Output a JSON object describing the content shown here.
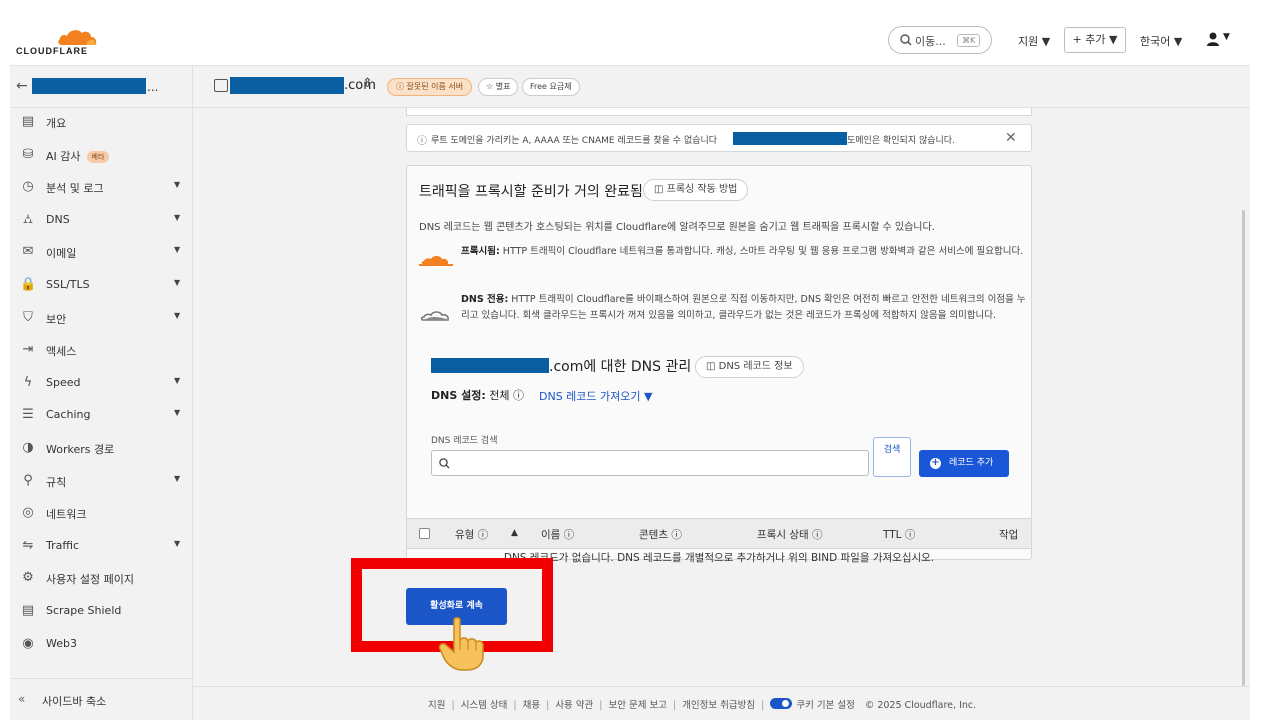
{
  "topbar": {
    "logo_text": "CLOUDFLARE",
    "search_label": "이동...",
    "search_shortcut": "⌘K",
    "support_label": "지원 ▼",
    "add_label": "+ 추가 ▼",
    "language_label": "한국어 ▼",
    "account_menu_label": "▼"
  },
  "subbar": {
    "account_suffix": "...",
    "domain_tld": ".com",
    "domain_chevron": "⌃⌄",
    "badge_warning": "ⓘ 잘못된 이름 서버",
    "badge_star": "☆ 별표",
    "badge_plan": "Free 요금제"
  },
  "sidebar": {
    "items": [
      {
        "icon": "document-icon",
        "glyph": "▤",
        "label": "개요",
        "chevron": ""
      },
      {
        "icon": "ai-audit-icon",
        "glyph": "⛁",
        "label": "AI 감사",
        "chevron": "",
        "badge": "베타"
      },
      {
        "icon": "analytics-icon",
        "glyph": "◷",
        "label": "분석 및 로그",
        "chevron": "▼"
      },
      {
        "icon": "dns-icon",
        "glyph": "⛼",
        "label": "DNS",
        "chevron": "▼"
      },
      {
        "icon": "email-icon",
        "glyph": "✉",
        "label": "이메일",
        "chevron": "▼"
      },
      {
        "icon": "lock-icon",
        "glyph": "🔒",
        "label": "SSL/TLS",
        "chevron": "▼"
      },
      {
        "icon": "shield-icon",
        "glyph": "⛉",
        "label": "보안",
        "chevron": "▼"
      },
      {
        "icon": "access-icon",
        "glyph": "⇥",
        "label": "액세스",
        "chevron": ""
      },
      {
        "icon": "speed-icon",
        "glyph": "ϟ",
        "label": "Speed",
        "chevron": "▼"
      },
      {
        "icon": "caching-icon",
        "glyph": "☰",
        "label": "Caching",
        "chevron": "▼"
      },
      {
        "icon": "workers-icon",
        "glyph": "◑",
        "label": "Workers 경로",
        "chevron": ""
      },
      {
        "icon": "rules-icon",
        "glyph": "⚲",
        "label": "규칙",
        "chevron": "▼"
      },
      {
        "icon": "network-icon",
        "glyph": "◎",
        "label": "네트워크",
        "chevron": ""
      },
      {
        "icon": "traffic-icon",
        "glyph": "⇋",
        "label": "Traffic",
        "chevron": "▼"
      },
      {
        "icon": "custom-pages-icon",
        "glyph": "⚙",
        "label": "사용자 설정 페이지",
        "chevron": ""
      },
      {
        "icon": "scrape-shield-icon",
        "glyph": "▤",
        "label": "Scrape Shield",
        "chevron": ""
      },
      {
        "icon": "web3-icon",
        "glyph": "◉",
        "label": "Web3",
        "chevron": ""
      }
    ],
    "collapse_label": "사이드바 축소"
  },
  "notice": {
    "text_before": "루트 도메인을 가리키는 A, AAAA 또는 CNAME 레코드를 찾을 수 없습니다",
    "text_after": "도메인은 확인되지 않습니다."
  },
  "card": {
    "title": "트래픽을 프록시할 준비가 거의 완료됨",
    "how_proxy_label": "◫ 프록싱 작동 방법",
    "description": "DNS 레코드는 웹 콘텐츠가 호스팅되는 위치를 Cloudflare에 알려주므로 원본을 숨기고 웹 트래픽을 프록시할 수 있습니다.",
    "proxied_title": "프록시됨:",
    "proxied_text": "HTTP 트래픽이 Cloudflare 네트워크를 통과합니다. 캐싱, 스마트 라우팅 및 웹 응용 프로그램 방화벽과 같은 서비스에 필요합니다.",
    "dns_only_title": "DNS 전용:",
    "dns_only_text": "HTTP 트래픽이 Cloudflare를 바이패스하여 원본으로 직접 이동하지만, DNS 확인은 여전히 빠르고 안전한 네트워크의 이점을 누리고 있습니다. 회색 클라우드는 프록시가 꺼져 있음을 의미하고, 클라우드가 없는 것은 레코드가 프록싱에 적합하지 않음을 의미합니다.",
    "dns_manage_suffix": ".com에 대한 DNS 관리",
    "dns_record_info_label": "◫ DNS 레코드 정보",
    "dns_settings_label": "DNS 설정:",
    "dns_settings_value": "전체 ⓘ",
    "dns_import_label": "DNS 레코드 가져오기 ▼",
    "search_label": "DNS 레코드 검색",
    "search_button_label": "검색",
    "add_record_label": "레코드 추가",
    "columns": [
      "유형 ⓘ",
      "▲",
      "이름 ⓘ",
      "콘텐츠 ⓘ",
      "프록시 상태 ⓘ",
      "TTL ⓘ",
      "작업"
    ],
    "empty_message": "DNS 레코드가 없습니다. DNS 레코드를 개별적으로 추가하거나 위의 BIND 파일을 가져오십시오."
  },
  "continue_button_label": "활성화로 계속",
  "footer": {
    "links": [
      "지원",
      "시스템 상태",
      "채용",
      "사용 약관",
      "보안 문제 보고",
      "개인정보 취급방침"
    ],
    "cookie_label": "쿠키 기본 설정",
    "copyright": "© 2025 Cloudflare, Inc."
  },
  "colors": {
    "accent_blue": "#1a56c8",
    "cloudflare_orange": "#f48120",
    "highlight_red": "#f00000",
    "redaction_blue": "#0a5fa3"
  }
}
